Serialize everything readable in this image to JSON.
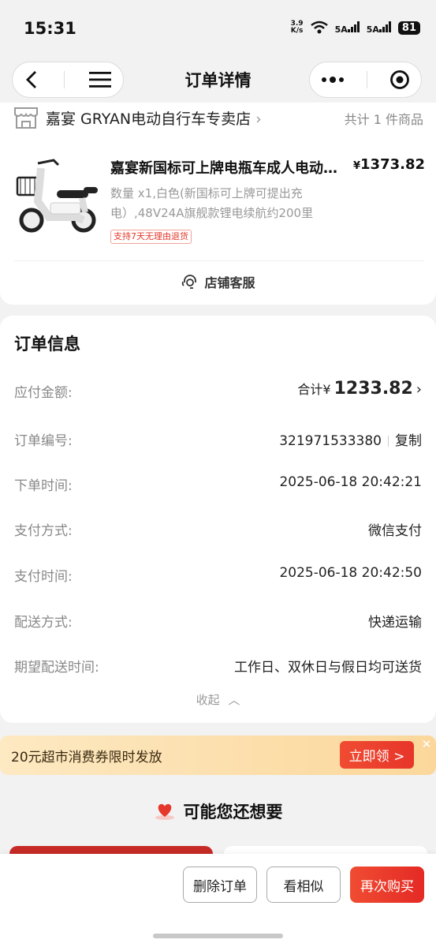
{
  "status_bar": {
    "time": "15:31",
    "net_speed_value": "3.9",
    "net_speed_unit": "K/s",
    "signal1": "5A",
    "signal2": "5A",
    "battery": "81"
  },
  "nav": {
    "title": "订单详情",
    "back_icon": "back-icon",
    "menu_icon": "menu-icon",
    "more_icon": "more-icon",
    "target_icon": "target-icon"
  },
  "store": {
    "name": "嘉宴 GRYAN电动自行车专卖店",
    "count": "共计 1 件商品"
  },
  "product": {
    "title": "嘉宴新国标可上牌电瓶车成人电动自行车",
    "price_symbol": "¥",
    "price": "1373.82",
    "spec": "数量 x1,白色(新国标可上牌可提出充电）,48V24A旗舰款锂电续航约200里",
    "tag": "支持7天无理由退货"
  },
  "service": {
    "label": "店铺客服"
  },
  "order_info": {
    "heading": "订单信息",
    "payable_label": "应付金额:",
    "payable_prefix": "合计¥",
    "payable_amount": "1233.82",
    "order_no_label": "订单编号:",
    "order_no": "321971533380",
    "copy_label": "复制",
    "order_time_label": "下单时间:",
    "order_time": "2025-06-18 20:42:21",
    "pay_method_label": "支付方式:",
    "pay_method": "微信支付",
    "pay_time_label": "支付时间:",
    "pay_time": "2025-06-18 20:42:50",
    "delivery_label": "配送方式:",
    "delivery": "快递运输",
    "expect_label": "期望配送时间:",
    "expect": "工作日、双休日与假日均可送货",
    "collapse": "收起"
  },
  "coupon": {
    "text": "20元超市消费券限时发放",
    "button": "立即领 >"
  },
  "recommend": {
    "title": "可能您还想要"
  },
  "bottom": {
    "delete": "删除订单",
    "similar": "看相似",
    "rebuy": "再次购买"
  },
  "colors": {
    "accent": "#e5372b",
    "coupon_bg": "#fbd79b"
  }
}
